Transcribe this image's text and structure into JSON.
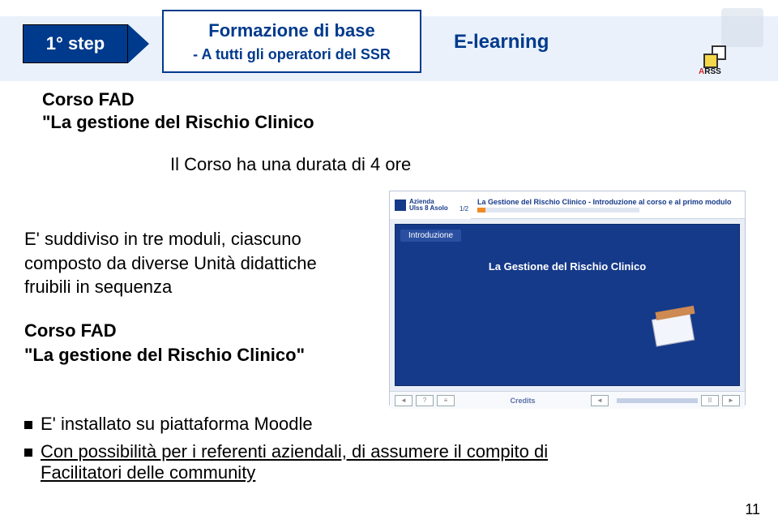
{
  "header": {
    "step_label": "1° step",
    "base_title_line1": "Formazione di base",
    "base_title_line2": "- A tutti gli operatori del SSR",
    "mode": "E-learning",
    "logo_label_a": "A",
    "logo_label_rest": "RSS"
  },
  "course": {
    "title_line1": "Corso FAD",
    "title_line2": "\"La gestione del Rischio Clinico",
    "duration": "Il Corso ha una durata di 4 ore"
  },
  "body": {
    "para1": "E' suddiviso in tre moduli, ciascuno composto da diverse Unità didattiche fruibili in sequenza",
    "fad_title": "Corso FAD",
    "fad_sub": "\"La gestione del Rischio Clinico\""
  },
  "bullets": {
    "b1": "E' installato su piattaforma Moodle",
    "b2_u1": "Con possibilità per i referenti aziendali, di assumere il compito di",
    "b2_u2": "Facilitatori delle community"
  },
  "player": {
    "azienda_line1": "Azienda",
    "azienda_line2": "Ulss 8 Asolo",
    "long_title": "La Gestione del Rischio Clinico - Introduzione al corso e al primo modulo",
    "progress_label": "1/2",
    "tab": "Introduzione",
    "slide_title": "La Gestione del Rischio Clinico",
    "credits": "Credits",
    "btn_back": "◄",
    "btn_q": "?",
    "btn_list": "≡",
    "btn_prev": "◄",
    "btn_next": "►",
    "btn_pause": "II"
  },
  "page_number": "11"
}
